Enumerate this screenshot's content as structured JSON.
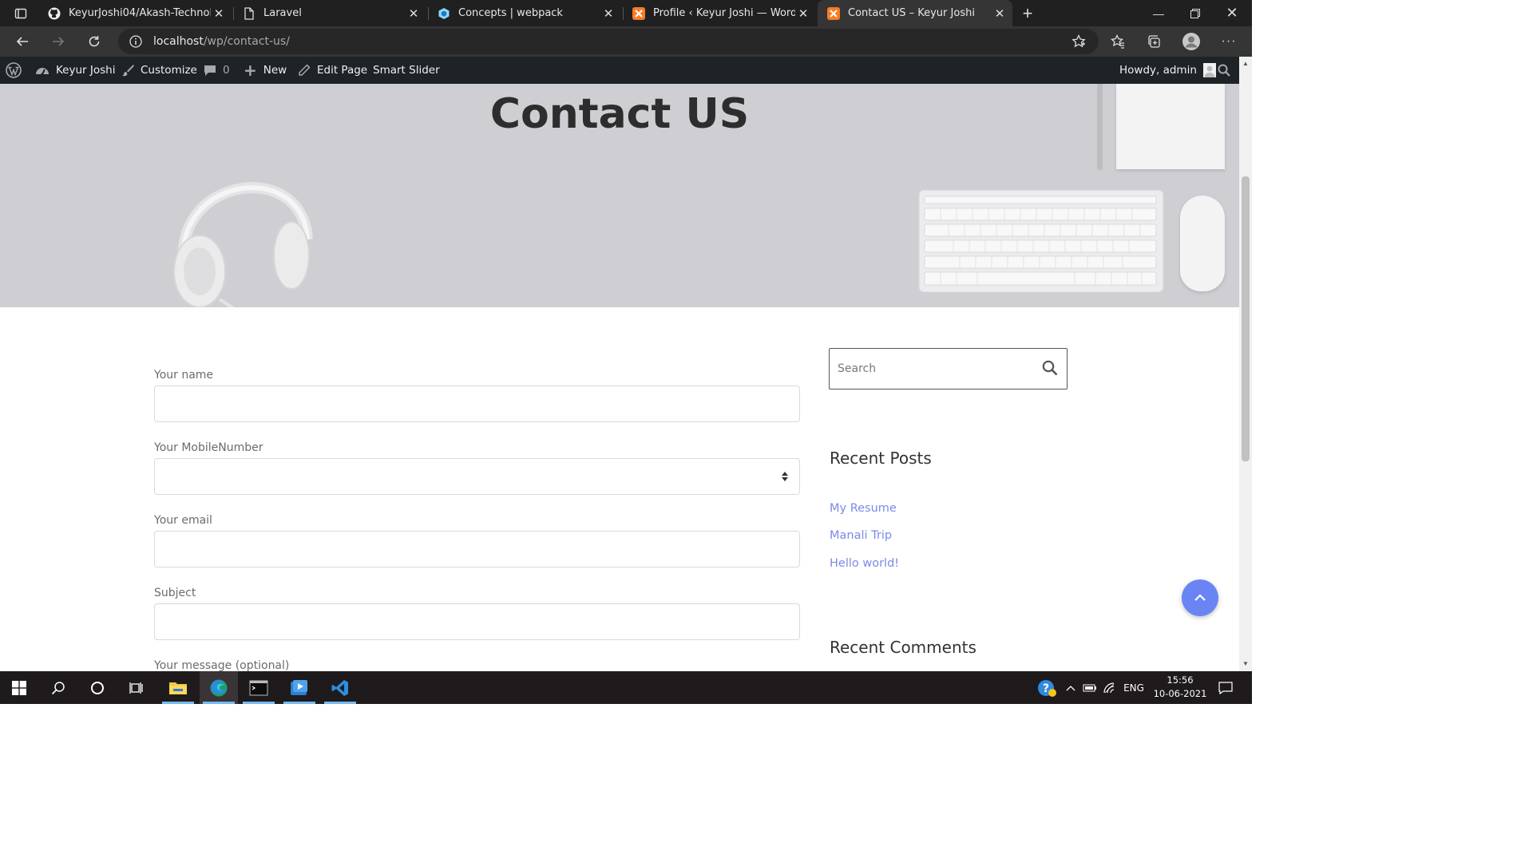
{
  "browser": {
    "tabs": [
      {
        "title": "KeyurJoshi04/Akash-Technolabs-",
        "icon": "github-icon"
      },
      {
        "title": "Laravel",
        "icon": "page-icon"
      },
      {
        "title": "Concepts | webpack",
        "icon": "webpack-icon"
      },
      {
        "title": "Profile ‹ Keyur Joshi — WordPress",
        "icon": "xampp-icon"
      },
      {
        "title": "Contact US – Keyur Joshi",
        "icon": "xampp-icon",
        "active": true
      }
    ],
    "url_host": "localhost",
    "url_path": "/wp/contact-us/"
  },
  "adminbar": {
    "site_name": "Keyur Joshi",
    "customize": "Customize",
    "comments_count": "0",
    "new": "New",
    "edit_page": "Edit Page",
    "smart_slider": "Smart Slider",
    "howdy": "Howdy, admin"
  },
  "hero": {
    "title": "Contact US"
  },
  "form": {
    "name_label": "Your name",
    "mobile_label": "Your MobileNumber",
    "email_label": "Your email",
    "subject_label": "Subject",
    "message_label": "Your message (optional)"
  },
  "sidebar": {
    "search_placeholder": "Search",
    "recent_posts_title": "Recent Posts",
    "recent_posts": [
      "My Resume",
      "Manali Trip",
      "Hello world!"
    ],
    "recent_comments_title": "Recent Comments"
  },
  "taskbar": {
    "language": "ENG",
    "time": "15:56",
    "date": "10-06-2021"
  },
  "colors": {
    "link": "#7b8ae6",
    "to_top_button": "#6b84f3",
    "admin_bar": "#1d2327",
    "hero_bg": "#cfced3"
  }
}
